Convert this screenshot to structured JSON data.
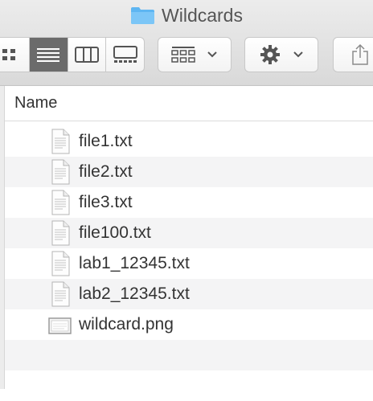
{
  "window": {
    "title": "Wildcards"
  },
  "toolbar": {
    "view_modes": [
      "icon-view",
      "list-view",
      "column-view",
      "gallery-view"
    ],
    "active_view": "list-view",
    "group_button": "group-by",
    "action_button": "action-gear",
    "share_button": "share"
  },
  "list": {
    "column_header": "Name",
    "files": [
      {
        "name": "file1.txt",
        "icon": "text-file-icon"
      },
      {
        "name": "file2.txt",
        "icon": "text-file-icon"
      },
      {
        "name": "file3.txt",
        "icon": "text-file-icon"
      },
      {
        "name": "file100.txt",
        "icon": "text-file-icon"
      },
      {
        "name": "lab1_12345.txt",
        "icon": "text-file-icon"
      },
      {
        "name": "lab2_12345.txt",
        "icon": "text-file-icon"
      },
      {
        "name": "wildcard.png",
        "icon": "image-file-icon"
      }
    ]
  },
  "colors": {
    "folder": "#5eb6f2",
    "active_segment": "#6b6b6b",
    "row_alt": "#f4f4f5"
  }
}
